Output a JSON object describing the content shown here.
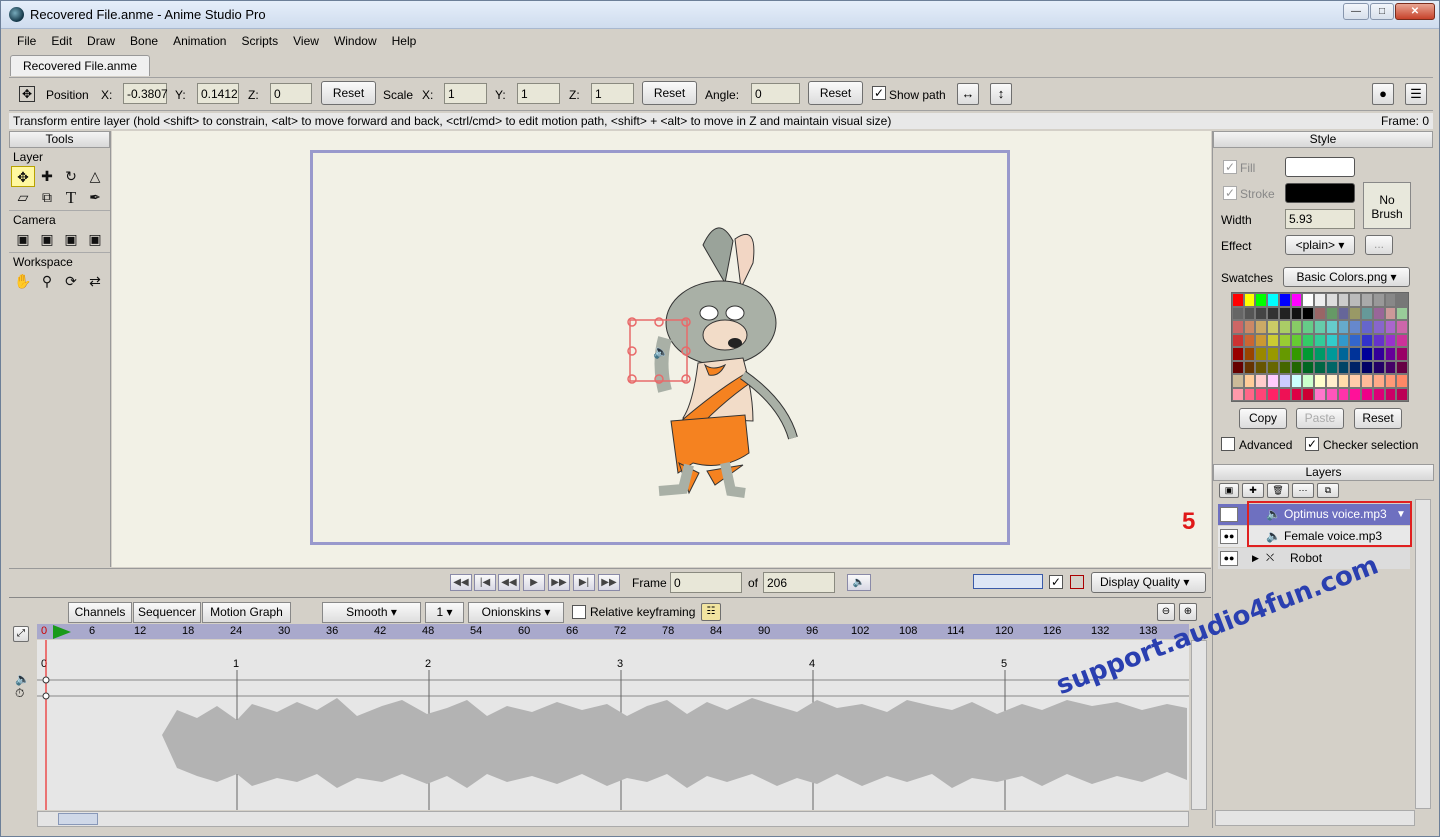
{
  "window": {
    "title": "Recovered File.anme - Anime Studio Pro"
  },
  "menu": [
    "File",
    "Edit",
    "Draw",
    "Bone",
    "Animation",
    "Scripts",
    "View",
    "Window",
    "Help"
  ],
  "doc_tab": "Recovered File.anme",
  "toolbar": {
    "position_label": "Position",
    "x_label": "X:",
    "x_value": "-0.3807",
    "y_label": "Y:",
    "y_value": "0.1412",
    "z_label": "Z:",
    "z_value": "0",
    "reset1": "Reset",
    "scale_label": "Scale",
    "sx_label": "X:",
    "sx_value": "1",
    "sy_label": "Y:",
    "sy_value": "1",
    "sz_label": "Z:",
    "sz_value": "1",
    "reset2": "Reset",
    "angle_label": "Angle:",
    "angle_value": "0",
    "reset3": "Reset",
    "show_path": "Show path"
  },
  "status": {
    "hint": "Transform entire layer (hold <shift> to constrain, <alt> to move forward and back, <ctrl/cmd> to edit motion path, <shift> + <alt> to move in Z and maintain visual size)",
    "frame": "Frame: 0"
  },
  "tools": {
    "header": "Tools",
    "layer": "Layer",
    "camera": "Camera",
    "workspace": "Workspace"
  },
  "playback": {
    "frame_label": "Frame",
    "frame_value": "0",
    "of_label": "of",
    "total": "206",
    "display_quality": "Display Quality"
  },
  "timeline": {
    "tabs": [
      "Channels",
      "Sequencer",
      "Motion Graph"
    ],
    "interp": "Smooth",
    "interp_n": "1",
    "onionskins": "Onionskins",
    "relative": "Relative keyframing",
    "ruler": [
      "0",
      "6",
      "12",
      "18",
      "24",
      "30",
      "36",
      "42",
      "48",
      "54",
      "60",
      "66",
      "72",
      "78",
      "84",
      "90",
      "96",
      "102",
      "108",
      "114",
      "120",
      "126",
      "132",
      "138"
    ],
    "seconds": [
      "0",
      "1",
      "2",
      "3",
      "4",
      "5"
    ]
  },
  "style": {
    "header": "Style",
    "fill": "Fill",
    "stroke": "Stroke",
    "width_label": "Width",
    "width_value": "5.93",
    "effect_label": "Effect",
    "effect_value": "<plain>",
    "more": "...",
    "no_brush": "No Brush",
    "swatches_label": "Swatches",
    "swatches_value": "Basic Colors.png",
    "copy": "Copy",
    "paste": "Paste",
    "reset": "Reset",
    "advanced": "Advanced",
    "checker": "Checker selection",
    "fill_color": "#ffffff",
    "stroke_color": "#000000"
  },
  "layers": {
    "header": "Layers",
    "items": [
      "Optimus voice.mp3",
      "Female voice.mp3",
      "Robot"
    ]
  },
  "annotation": {
    "number": "5",
    "watermark": "support.audio4fun.com"
  }
}
